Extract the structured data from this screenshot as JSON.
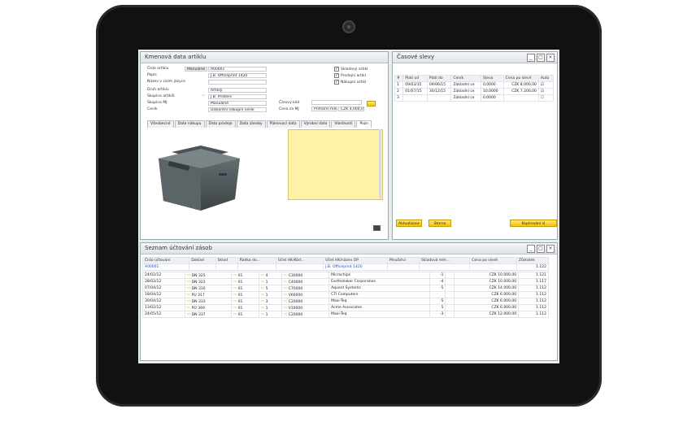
{
  "item_master": {
    "title": "Kmenová data artiklu",
    "fields": [
      {
        "label": "Číslo artiklu",
        "value": "A00001",
        "prefix": "Manuálně"
      },
      {
        "label": "Popis",
        "value": "J.B. Officeprint 1420"
      },
      {
        "label": "Název v cizím jazyce",
        "value": ""
      },
      {
        "label": "Druh artiklu",
        "value": "Artikly"
      },
      {
        "label": "Skupina artiklů",
        "value": "J.B. Printers"
      },
      {
        "label": "Skupina MJ",
        "value": "Manuálně"
      },
      {
        "label": "Ceník",
        "value": "Diskontní nákupní ceník"
      }
    ],
    "checkboxes": [
      "Skladový artikl",
      "Prodejní artikl",
      "Nákupní artikl"
    ],
    "barcode_label": "Čárový kód",
    "price_label": "Cena za MJ",
    "price_unit": "Primární měna",
    "price_value": "CZK 4.000,00",
    "tabs": [
      "Všeobecné",
      "Data nákupu",
      "Data prodeje",
      "Data zásoby",
      "Plánovací data",
      "Výrobní data",
      "Vlastnosti",
      "Pozn"
    ]
  },
  "time_discounts": {
    "title": "Časové slevy",
    "headers": [
      "#",
      "Platí od",
      "Platí do",
      "Ceník",
      "Sleva",
      "Cena po slevě",
      "Auto"
    ],
    "rows": [
      [
        "1",
        "09/03/15",
        "09/06/15",
        "Základní ce",
        "0,0000",
        "CZK 8.000,00"
      ],
      [
        "2",
        "01/07/15",
        "30/12/15",
        "Základní ce",
        "10,0000",
        "CZK 7.200,00"
      ],
      [
        "3",
        "",
        "",
        "Základní ce",
        "0,0000",
        ""
      ]
    ],
    "btn_update": "Aktualizace",
    "btn_cancel": "Storno",
    "btn_copy": "Kopírování sl"
  },
  "journal": {
    "title": "Seznam účtování zásob",
    "headers": [
      "Číslo účtování",
      "Doklad",
      "Sklad",
      "Řádka do...",
      "Účet HK/Kód...",
      "Účet HK/název OP",
      "Množství",
      "Skladová měr...",
      "Cena po slevě",
      "Zůstatek"
    ],
    "first_row": {
      "code": "A00001",
      "name": "J.B. Officeprint 1420",
      "balance": "1.122"
    },
    "rows": [
      [
        "24/02/12",
        "DN 325",
        "01",
        "4",
        "C30000",
        "Microchips",
        "-1",
        "CZK 10.000,00",
        "1.121"
      ],
      [
        "28/02/12",
        "DN 322",
        "01",
        "1",
        "C40000",
        "Earthshaker Corporation",
        "-4",
        "CZK 10.000,00",
        "1.117"
      ],
      [
        "07/04/12",
        "DN 316",
        "01",
        "5",
        "C70000",
        "Aquent Systems",
        "-5",
        "CZK 14.000,00",
        "1.112"
      ],
      [
        "18/04/12",
        "PU 317",
        "01",
        "1",
        "V60000",
        "CTI Computers",
        "",
        "CZK 6.000,00",
        "1.112"
      ],
      [
        "30/04/12",
        "DN 333",
        "01",
        "3",
        "C20000",
        "Maxi-Teq",
        "-5",
        "CZK 6.000,00",
        "1.112"
      ],
      [
        "13/02/12",
        "PO 369",
        "01",
        "1",
        "V10000",
        "Acme Associates",
        "5",
        "CZK 6.000,00",
        "1.112"
      ],
      [
        "24/05/12",
        "DN 337",
        "01",
        "1",
        "C20000",
        "Maxi-Teq",
        "-3",
        "CZK 12.000,00",
        "1.112"
      ]
    ]
  }
}
